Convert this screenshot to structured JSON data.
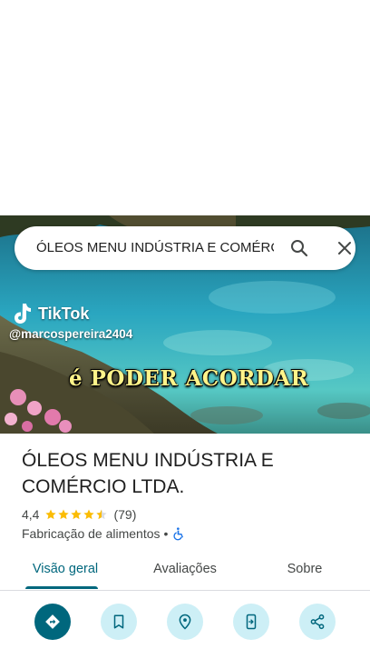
{
  "search": {
    "query": "ÓLEOS MENU INDÚSTRIA E COMÉRCIO LTDA."
  },
  "hero": {
    "tiktok_brand": "TikTok",
    "tiktok_handle": "@marcospereira2404",
    "caption": "é PODER ACORDAR"
  },
  "place": {
    "title": "ÓLEOS MENU INDÚSTRIA E COMÉRCIO LTDA.",
    "rating": "4,4",
    "rating_value": 4.4,
    "review_count": "(79)",
    "category": "Fabricação de alimentos",
    "separator": "•"
  },
  "tabs": [
    {
      "label": "Visão geral",
      "active": true
    },
    {
      "label": "Avaliações",
      "active": false
    },
    {
      "label": "Sobre",
      "active": false
    }
  ],
  "actions": [
    {
      "icon": "directions-icon"
    },
    {
      "icon": "bookmark-icon"
    },
    {
      "icon": "nearby-icon"
    },
    {
      "icon": "send-to-phone-icon"
    },
    {
      "icon": "share-icon"
    }
  ],
  "colors": {
    "accent": "#00677d",
    "action_bg": "#cdeff6",
    "star": "#fbbc04",
    "caption": "#fff48a"
  }
}
